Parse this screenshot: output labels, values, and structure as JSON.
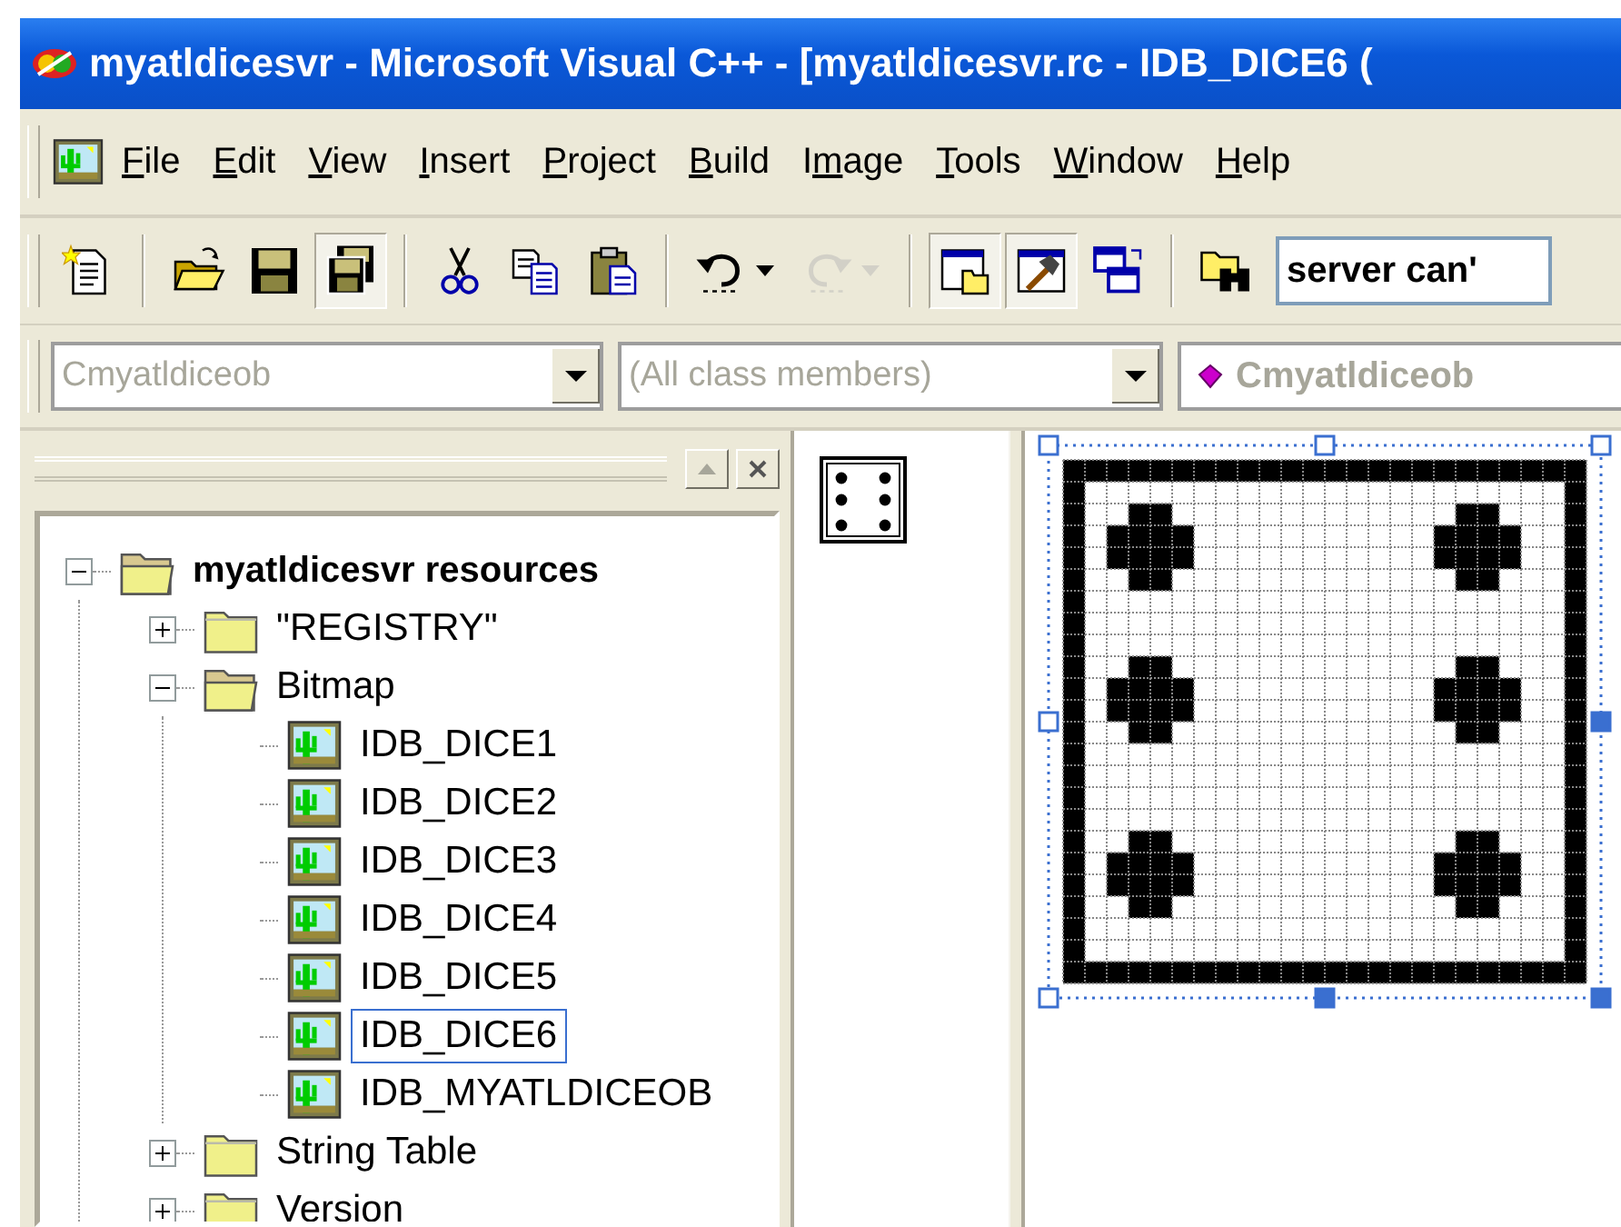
{
  "window": {
    "title": "myatldicesvr - Microsoft Visual C++ - [myatldicesvr.rc - IDB_DICE6 ("
  },
  "menu": [
    {
      "key": "F",
      "post": "ile"
    },
    {
      "key": "E",
      "post": "dit"
    },
    {
      "key": "V",
      "post": "iew"
    },
    {
      "key": "I",
      "post": "nsert"
    },
    {
      "key": "P",
      "post": "roject"
    },
    {
      "key": "B",
      "post": "uild"
    },
    {
      "pre": "I",
      "key": "m",
      "post": "age"
    },
    {
      "key": "T",
      "post": "ools"
    },
    {
      "key": "W",
      "post": "indow"
    },
    {
      "key": "H",
      "post": "elp"
    }
  ],
  "toolbar": {
    "items": [
      {
        "kind": "button",
        "pressed": false,
        "disabled": false
      },
      {
        "kind": "separator"
      },
      {
        "kind": "button",
        "pressed": false,
        "disabled": false
      },
      {
        "kind": "button",
        "pressed": false,
        "disabled": false
      },
      {
        "kind": "button",
        "pressed": true,
        "disabled": false
      },
      {
        "kind": "separator"
      },
      {
        "kind": "button",
        "pressed": false,
        "disabled": false
      },
      {
        "kind": "button",
        "pressed": false,
        "disabled": false
      },
      {
        "kind": "button",
        "pressed": false,
        "disabled": false
      },
      {
        "kind": "separator"
      },
      {
        "kind": "split",
        "pressed": false,
        "disabled": false
      },
      {
        "kind": "split",
        "pressed": false,
        "disabled": true
      },
      {
        "kind": "separator"
      },
      {
        "kind": "button",
        "pressed": true,
        "disabled": false
      },
      {
        "kind": "button",
        "pressed": true,
        "disabled": false
      },
      {
        "kind": "button",
        "pressed": false,
        "disabled": false
      },
      {
        "kind": "separator"
      },
      {
        "kind": "button",
        "pressed": false,
        "disabled": false
      }
    ],
    "find_field": {
      "value": "server can'"
    }
  },
  "class_bar": {
    "class_combo": {
      "value": "Cmyatldiceob",
      "disabled": true
    },
    "members_combo": {
      "value": "(All class members)",
      "disabled": true
    },
    "member_field": {
      "value": "Cmyatldiceob",
      "disabled": true
    }
  },
  "workspace": {
    "tree": [
      {
        "label": "myatldicesvr resources",
        "kind": "root",
        "expanded": true,
        "selected": false,
        "children": [
          {
            "label": "\"REGISTRY\"",
            "kind": "folder",
            "expanded": false,
            "selected": false
          },
          {
            "label": "Bitmap",
            "kind": "folder",
            "expanded": true,
            "selected": false,
            "children": [
              {
                "label": "IDB_DICE1",
                "kind": "bitmap",
                "selected": false
              },
              {
                "label": "IDB_DICE2",
                "kind": "bitmap",
                "selected": false
              },
              {
                "label": "IDB_DICE3",
                "kind": "bitmap",
                "selected": false
              },
              {
                "label": "IDB_DICE4",
                "kind": "bitmap",
                "selected": false
              },
              {
                "label": "IDB_DICE5",
                "kind": "bitmap",
                "selected": false
              },
              {
                "label": "IDB_DICE6",
                "kind": "bitmap",
                "selected": true
              },
              {
                "label": "IDB_MYATLDICEOB",
                "kind": "bitmap",
                "selected": false
              }
            ]
          },
          {
            "label": "String Table",
            "kind": "folder",
            "expanded": false,
            "selected": false
          },
          {
            "label": "Version",
            "kind": "folder",
            "expanded": false,
            "selected": false
          }
        ]
      }
    ]
  }
}
